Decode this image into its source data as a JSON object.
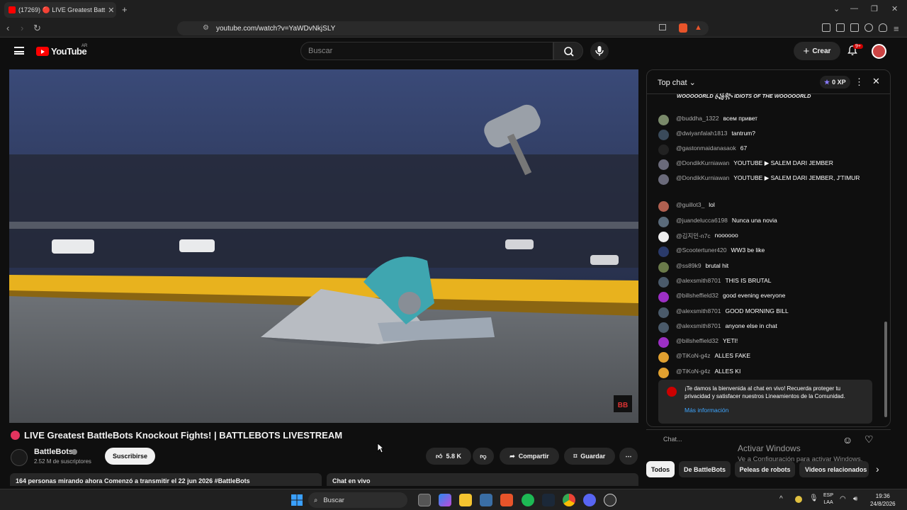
{
  "browser": {
    "tab_title": "(17269) 🔴 LIVE Greatest Batt",
    "tab_close": "✕",
    "new_tab": "+",
    "url": "youtube.com/watch?v=YaWDvNkjSLY"
  },
  "youtube": {
    "logo_text": "YouTube",
    "country": "AR",
    "search_placeholder": "Buscar",
    "create_label": "Crear",
    "notif_count": "9+"
  },
  "video": {
    "title": "LIVE Greatest BattleBots Knockout Fights! | BATTLEBOTS LIVESTREAM",
    "channel_name": "BattleBots",
    "subscribers": "2.52 M de suscriptores",
    "subscribe_label": "Suscribirse",
    "likes": "5.8 K",
    "share_label": "Compartir",
    "save_label": "Guardar",
    "more": "⋯",
    "description_line": "164 personas mirando ahora  Comenzó a transmitir el 22 jun 2026  #BattleBots",
    "live_chat_label": "Chat en vivo",
    "watermark": "BB"
  },
  "chat": {
    "header_title": "Top chat",
    "xp_label": "0 XP",
    "messages": [
      {
        "author": "@buddha_1322",
        "text": "всем привет",
        "avatar_color": "#7a8a6a"
      },
      {
        "author": "@dwiyanfalah1813",
        "text": "tantrum?",
        "avatar_color": "#3a4a5a"
      },
      {
        "author": "@gastonmaidanasaok",
        "text": "67",
        "avatar_color": "#222222"
      },
      {
        "author": "@DondikKurniawan",
        "text": "YOUTUBE ▶ SALEM DARI JEMBER",
        "avatar_color": "#6a6a7a"
      },
      {
        "author": "@DondikKurniawan",
        "text": "YOUTUBE ▶ SALEM DARI JEMBER, J'TIMUR",
        "avatar_color": "#6a6a7a"
      },
      {
        "author": "@guillot3_",
        "text": "lol",
        "avatar_color": "#b06050"
      },
      {
        "author": "@juandelucca6198",
        "text": "Nunca una novia",
        "avatar_color": "#5a6a7a"
      },
      {
        "author": "@김지민-n7c",
        "text": "noooooo",
        "avatar_color": "#eeeeee"
      },
      {
        "author": "@Scootertuner420",
        "text": "WW3 be like",
        "avatar_color": "#2a3a6a"
      },
      {
        "author": "@ss89k9",
        "text": "brutal hit",
        "avatar_color": "#6a7a4a"
      },
      {
        "author": "@alexsmith8701",
        "text": "THIS IS BRUTAL",
        "avatar_color": "#4a5a6a"
      },
      {
        "author": "@billsheffield32",
        "text": "good evening everyone",
        "avatar_color": "#9c2fc4"
      },
      {
        "author": "@alexsmith8701",
        "text": "GOOD MORNING BILL",
        "avatar_color": "#4a5a6a"
      },
      {
        "author": "@alexsmith8701",
        "text": "anyone else in chat",
        "avatar_color": "#4a5a6a"
      },
      {
        "author": "@billsheffield32",
        "text": "YETI!",
        "avatar_color": "#9c2fc4"
      },
      {
        "author": "@TiKoN-g4z",
        "text": "ALLES FAKE",
        "avatar_color": "#e0a030"
      },
      {
        "author": "@TiKoN-g4z",
        "text": "ALLES KI",
        "avatar_color": "#e0a030"
      }
    ],
    "welcome_text": "¡Te damos la bienvenida al chat en vivo! Recuerda proteger tu privacidad y satisfacer nuestros Lineamientos de la Comunidad.",
    "welcome_link": "Más información",
    "input_placeholder": "Chat...",
    "top_fragment": "WOOOOORLD ꧁ꦿ꧂ IDIOTS OF THE WOOOOORLD"
  },
  "chips": [
    "Todos",
    "De BattleBots",
    "Peleas de robots",
    "Videos relacionados"
  ],
  "windows_activation": {
    "line1": "Activar Windows",
    "line2": "Ve a Configuración para activar Windows."
  },
  "taskbar": {
    "search_label": "Buscar",
    "lang_top": "ESP",
    "lang_bottom": "LAA",
    "time": "19:36",
    "date": "24/8/2026"
  },
  "colors": {
    "accent_red": "#ff0000",
    "link_blue": "#3ea6ff",
    "background": "#0f0f0f"
  }
}
